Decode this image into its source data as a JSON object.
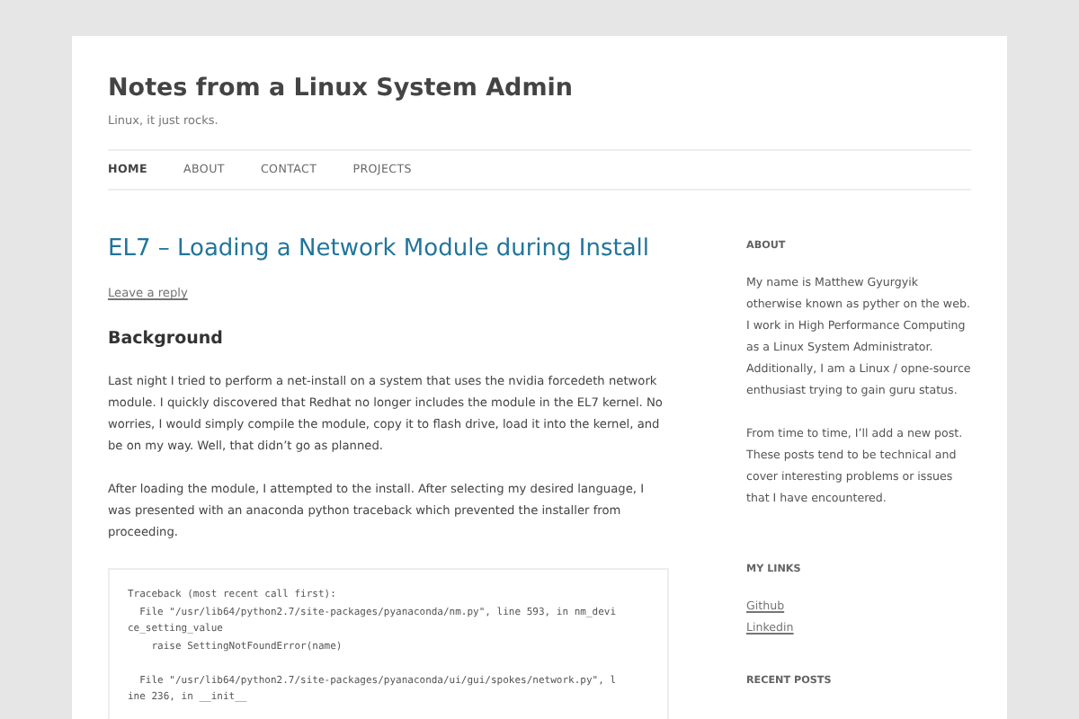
{
  "site": {
    "title": "Notes from a Linux System Admin",
    "tagline": "Linux, it just rocks."
  },
  "nav": [
    {
      "label": "HOME",
      "selected": true
    },
    {
      "label": "ABOUT",
      "selected": false
    },
    {
      "label": "CONTACT",
      "selected": false
    },
    {
      "label": "PROJECTS",
      "selected": false
    }
  ],
  "post": {
    "title": "EL7 – Loading a Network Module during Install",
    "reply_link": "Leave a reply",
    "heading": "Background",
    "paragraphs": [
      "Last night I tried to perform a net-install on a system that uses the nvidia forcedeth network module. I quickly discovered that Redhat no longer includes the module in the EL7 kernel. No worries, I would simply compile the module, copy it to flash drive, load it into the kernel, and be on my way. Well, that didn’t go as planned.",
      "After loading the module, I attempted to the install. After selecting my desired language, I was presented with an anaconda python traceback which prevented the installer from proceeding."
    ],
    "code_blocks": [
      [
        "Traceback (most recent call first):",
        "  File \"/usr/lib64/python2.7/site-packages/pyanaconda/nm.py\", line 593, in nm_devi",
        "ce_setting_value",
        "    raise SettingNotFoundError(name)"
      ],
      [
        "  File \"/usr/lib64/python2.7/site-packages/pyanaconda/ui/gui/spokes/network.py\", l",
        "ine 236, in __init__"
      ]
    ]
  },
  "sidebar": [
    {
      "kind": "text",
      "title": "ABOUT",
      "paragraphs": [
        "My name is Matthew Gyurgyik otherwise known as pyther on the web. I work in High Performance Computing as a Linux System Administrator. Additionally, I am a Linux / opne-source enthusiast trying to gain guru status.",
        "From time to time, I’ll add a new post. These posts tend to be technical and cover interesting problems or issues that I have encountered."
      ]
    },
    {
      "kind": "links",
      "title": "MY LINKS",
      "links": [
        "Github",
        "Linkedin"
      ]
    },
    {
      "kind": "heading",
      "title": "RECENT POSTS"
    }
  ]
}
